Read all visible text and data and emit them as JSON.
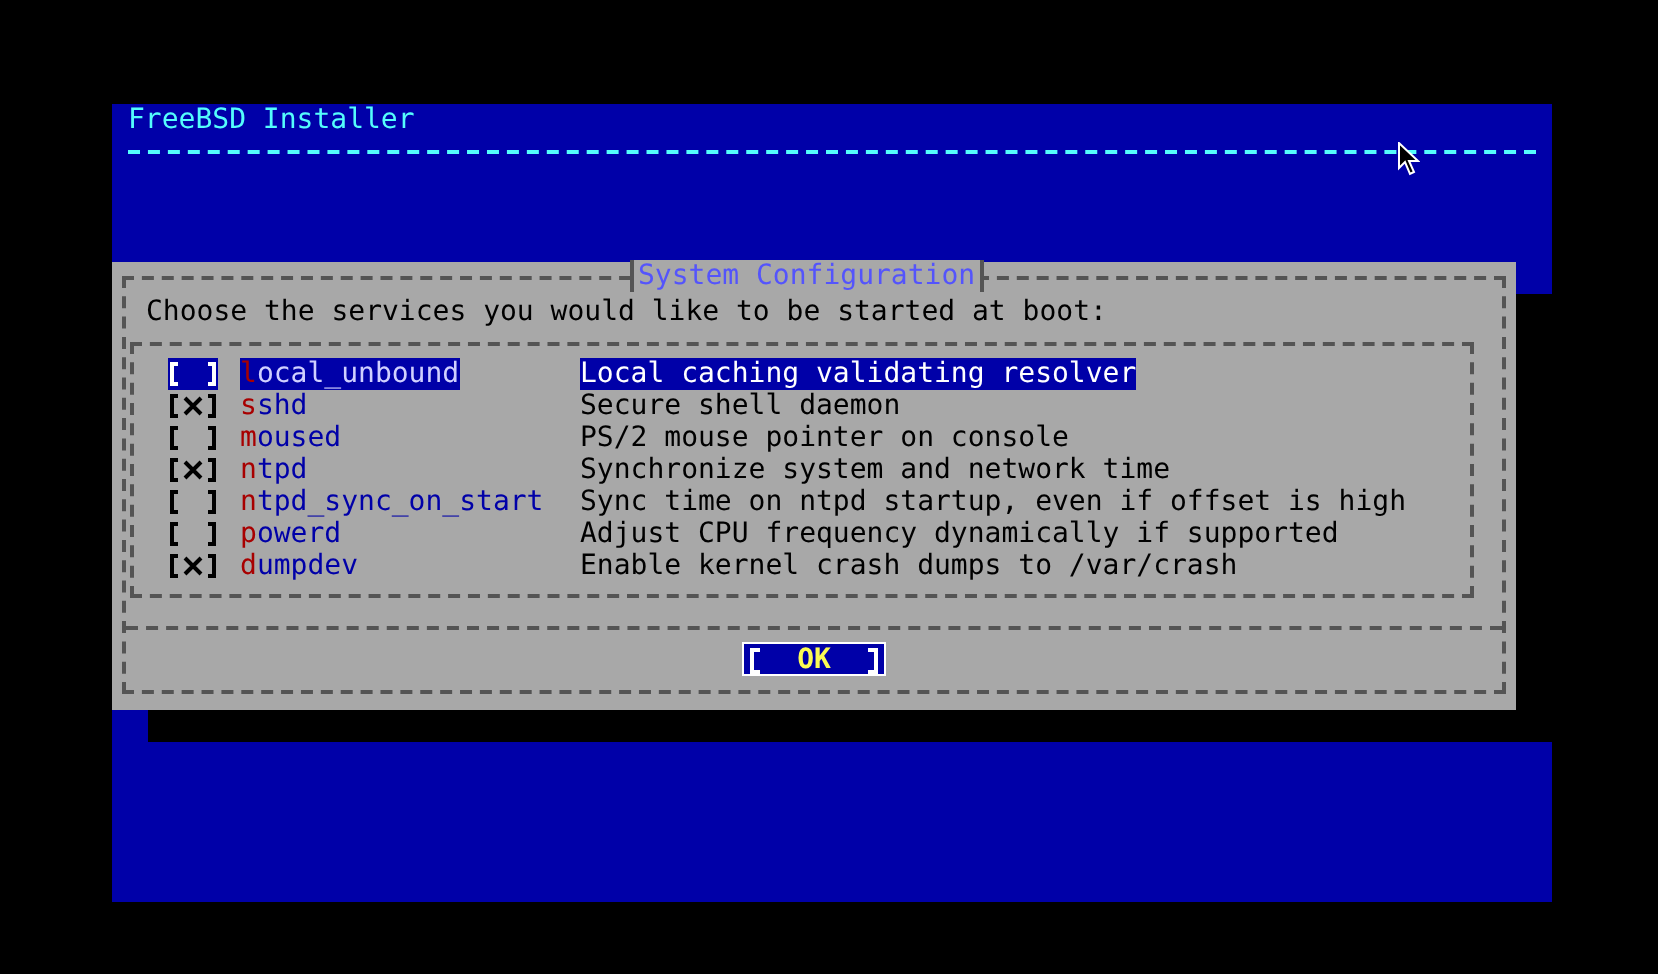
{
  "header": {
    "title": "FreeBSD Installer"
  },
  "dialog": {
    "title": "System Configuration",
    "prompt": "Choose the services you would like to be started at boot:",
    "services": [
      {
        "name": "local_unbound",
        "description": "Local caching validating resolver",
        "checked": false,
        "selected": true
      },
      {
        "name": "sshd",
        "description": "Secure shell daemon",
        "checked": true,
        "selected": false
      },
      {
        "name": "moused",
        "description": "PS/2 mouse pointer on console",
        "checked": false,
        "selected": false
      },
      {
        "name": "ntpd",
        "description": "Synchronize system and network time",
        "checked": true,
        "selected": false
      },
      {
        "name": "ntpd_sync_on_start",
        "description": "Sync time on ntpd startup, even if offset is high",
        "checked": false,
        "selected": false
      },
      {
        "name": "powerd",
        "description": "Adjust CPU frequency dynamically if supported",
        "checked": false,
        "selected": false
      },
      {
        "name": "dumpdev",
        "description": "Enable kernel crash dumps to /var/crash",
        "checked": true,
        "selected": false
      }
    ],
    "buttons": [
      {
        "label": "OK",
        "selected": true
      }
    ]
  }
}
